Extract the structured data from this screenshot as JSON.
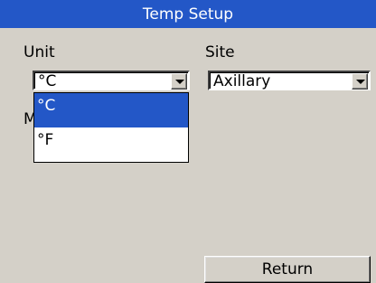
{
  "window": {
    "title": "Temp Setup"
  },
  "unit": {
    "label": "Unit",
    "selected": "°C",
    "options": [
      "°C",
      "°F"
    ],
    "highlighted_option": "°C"
  },
  "site": {
    "label": "Site",
    "selected": "Axillary"
  },
  "obscured_label_fragment": "M",
  "buttons": {
    "return_label": "Return"
  },
  "colors": {
    "titlebar": "#2357c7",
    "background": "#d4d0c8",
    "selection": "#2357c7"
  }
}
